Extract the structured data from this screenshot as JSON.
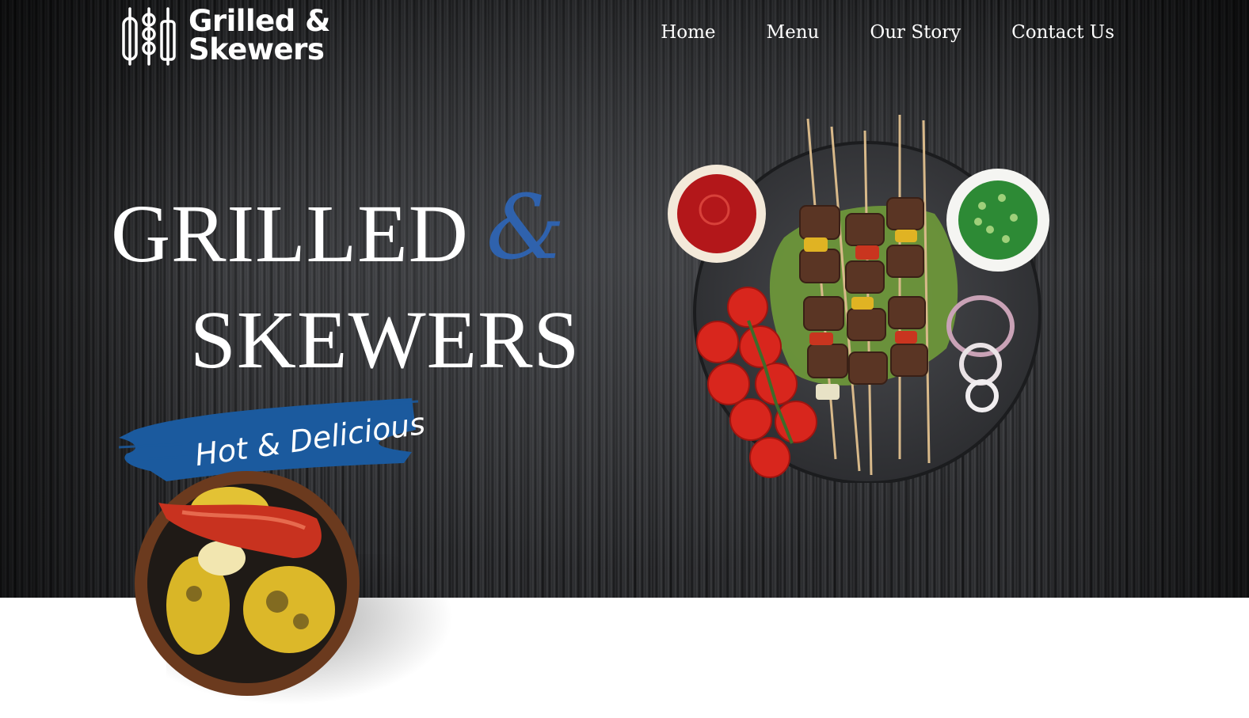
{
  "brand": {
    "name_line1": "Grilled &",
    "name_line2": "Skewers",
    "logo_icon": "skewers-logo-icon"
  },
  "nav": {
    "items": [
      {
        "label": "Home"
      },
      {
        "label": "Menu"
      },
      {
        "label": "Our Story"
      },
      {
        "label": "Contact Us"
      }
    ]
  },
  "hero": {
    "title_word1": "GRILLED",
    "title_amp": "&",
    "title_word2": "SKEWERS",
    "tagline": "Hot & Delicious",
    "images": [
      "skewer-platter-image",
      "grilled-corn-bowl-image"
    ]
  },
  "colors": {
    "accent_blue": "#2f62ad",
    "hero_background": "#2a2b2d",
    "text": "#ffffff"
  }
}
